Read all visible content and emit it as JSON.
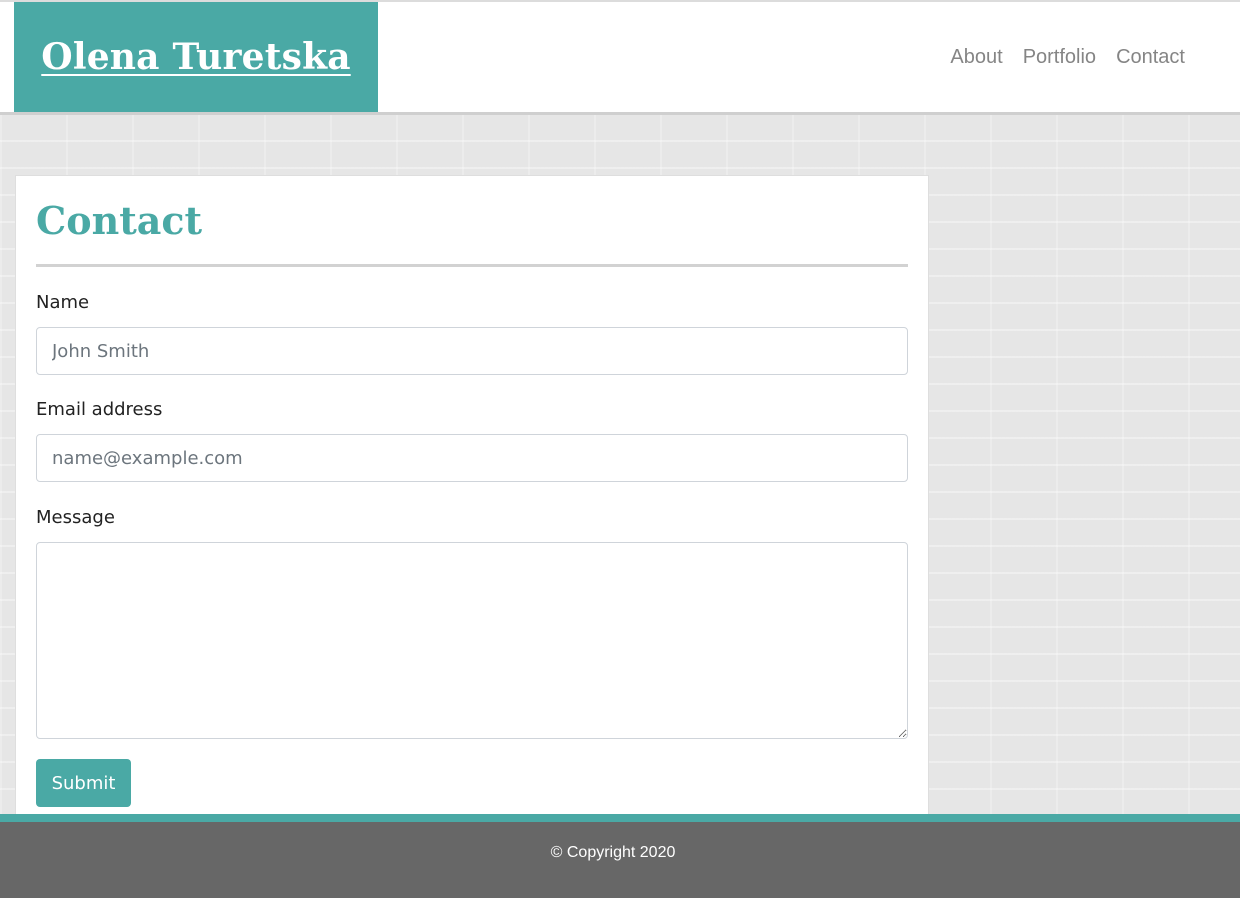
{
  "header": {
    "brand": "Olena Turetska",
    "nav": [
      {
        "label": "About"
      },
      {
        "label": "Portfolio"
      },
      {
        "label": "Contact"
      }
    ]
  },
  "contact": {
    "title": "Contact",
    "name_label": "Name",
    "name_placeholder": "John Smith",
    "email_label": "Email address",
    "email_placeholder": "name@example.com",
    "message_label": "Message",
    "message_value": "",
    "submit_label": "Submit"
  },
  "footer": {
    "copyright": "© Copyright 2020"
  },
  "colors": {
    "accent": "#4aa9a5",
    "footer_bg": "#676767",
    "nav_text": "#858585"
  }
}
